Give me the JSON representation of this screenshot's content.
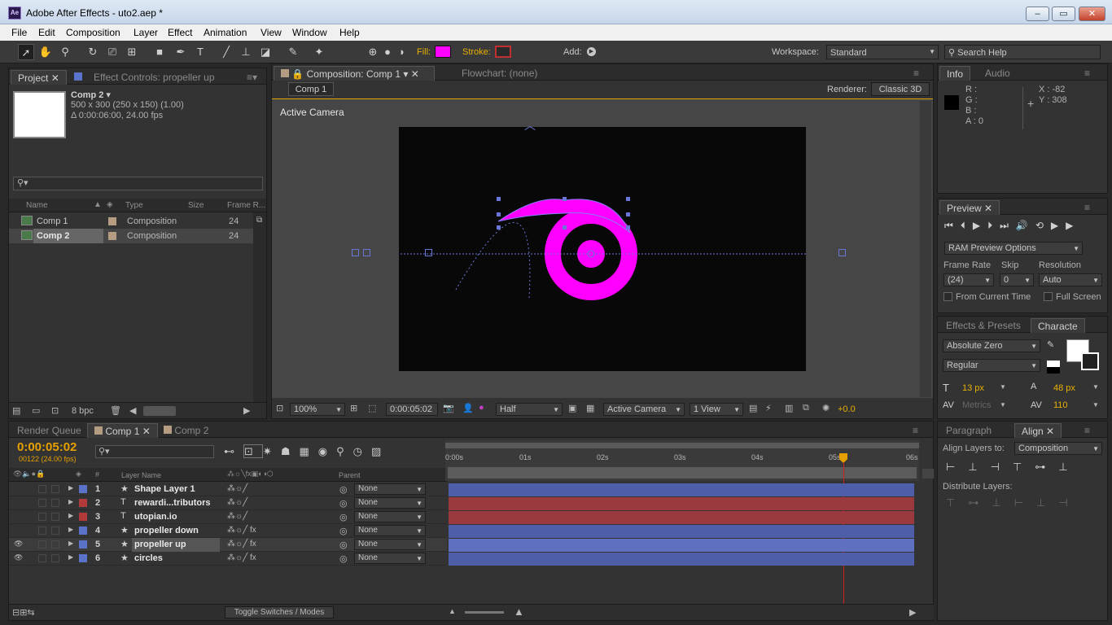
{
  "window": {
    "title": "Adobe After Effects - uto2.aep *",
    "logo": "Ae",
    "min": "–",
    "max": "▭",
    "close": "✕"
  },
  "menu": [
    "File",
    "Edit",
    "Composition",
    "Layer",
    "Effect",
    "Animation",
    "View",
    "Window",
    "Help"
  ],
  "toolbar": {
    "fill_label": "Fill:",
    "fill_color": "#ff00ff",
    "stroke_label": "Stroke:",
    "add_label": "Add:",
    "workspace_label": "Workspace:",
    "workspace_value": "Standard",
    "search_placeholder": "Search Help"
  },
  "project": {
    "tab_project": "Project",
    "tab_effect": "Effect Controls: propeller up",
    "comp_name": "Comp 2 ▾",
    "comp_size": "500 x 300  (250 x 150) (1.00)",
    "comp_duration": "Δ 0:00:06:00, 24.00 fps",
    "col_name": "Name",
    "col_type": "Type",
    "col_size": "Size",
    "col_frame": "Frame R...",
    "items": [
      {
        "name": "Comp 1",
        "type": "Composition",
        "fr": "24"
      },
      {
        "name": "Comp 2",
        "type": "Composition",
        "fr": "24"
      }
    ],
    "bpc": "8 bpc"
  },
  "comp": {
    "tab": "Composition: Comp 1",
    "flowchart": "Flowchart: (none)",
    "crumb": "Comp 1",
    "renderer_label": "Renderer:",
    "renderer": "Classic 3D",
    "active_camera": "Active Camera",
    "shape_color": "#ff00ff",
    "zoom": "100%",
    "timecode": "0:00:05:02",
    "resolution": "Half",
    "camera": "Active Camera",
    "view": "1 View",
    "exposure": "+0.0"
  },
  "info": {
    "tab_info": "Info",
    "tab_audio": "Audio",
    "r": "R :",
    "g": "G :",
    "b": "B :",
    "a": "A : 0",
    "x": "X : -82",
    "y": "Y : 308"
  },
  "preview": {
    "tab": "Preview",
    "ram": "RAM Preview Options",
    "frame_rate_label": "Frame Rate",
    "skip_label": "Skip",
    "resolution_label": "Resolution",
    "frame_rate": "(24)",
    "skip": "0",
    "resolution": "Auto",
    "from_current": "From Current Time",
    "full_screen": "Full Screen"
  },
  "character": {
    "tab_effects": "Effects & Presets",
    "tab_char": "Characte",
    "font": "Absolute Zero",
    "style": "Regular",
    "size": "13 px",
    "leading": "48 px",
    "metrics": "Metrics",
    "tracking": "110"
  },
  "align": {
    "tab_para": "Paragraph",
    "tab_align": "Align",
    "align_to_label": "Align Layers to:",
    "align_to": "Composition",
    "distribute": "Distribute Layers:"
  },
  "timeline": {
    "tab_render": "Render Queue",
    "tab_comp1": "Comp 1",
    "tab_comp2": "Comp 2",
    "timecode": "0:00:05:02",
    "frames": "00122 (24.00 fps)",
    "col_layer": "Layer Name",
    "col_parent": "Parent",
    "ruler": [
      "0:00s",
      "01s",
      "02s",
      "03s",
      "04s",
      "05s",
      "06s"
    ],
    "toggle": "Toggle Switches / Modes",
    "layers": [
      {
        "num": "1",
        "name": "Shape Layer 1",
        "label": "#5a72c8",
        "bar": "#4e5ea8",
        "kind": "★",
        "eye": false,
        "fx": false,
        "parent": "None"
      },
      {
        "num": "2",
        "name": "rewardi...tributors",
        "label": "#b23a3a",
        "bar": "#9a3a3e",
        "kind": "T",
        "eye": false,
        "fx": false,
        "parent": "None"
      },
      {
        "num": "3",
        "name": "utopian.io",
        "label": "#b23a3a",
        "bar": "#9a3a3e",
        "kind": "T",
        "eye": false,
        "fx": false,
        "parent": "None"
      },
      {
        "num": "4",
        "name": "propeller down",
        "label": "#5a72c8",
        "bar": "#4e5ea8",
        "kind": "★",
        "eye": false,
        "fx": true,
        "parent": "None"
      },
      {
        "num": "5",
        "name": "propeller up",
        "label": "#5a72c8",
        "bar": "#6070c0",
        "kind": "★",
        "eye": true,
        "fx": true,
        "parent": "None"
      },
      {
        "num": "6",
        "name": "circles",
        "label": "#5a72c8",
        "bar": "#4e5ea8",
        "kind": "★",
        "eye": true,
        "fx": true,
        "parent": "None"
      }
    ]
  }
}
